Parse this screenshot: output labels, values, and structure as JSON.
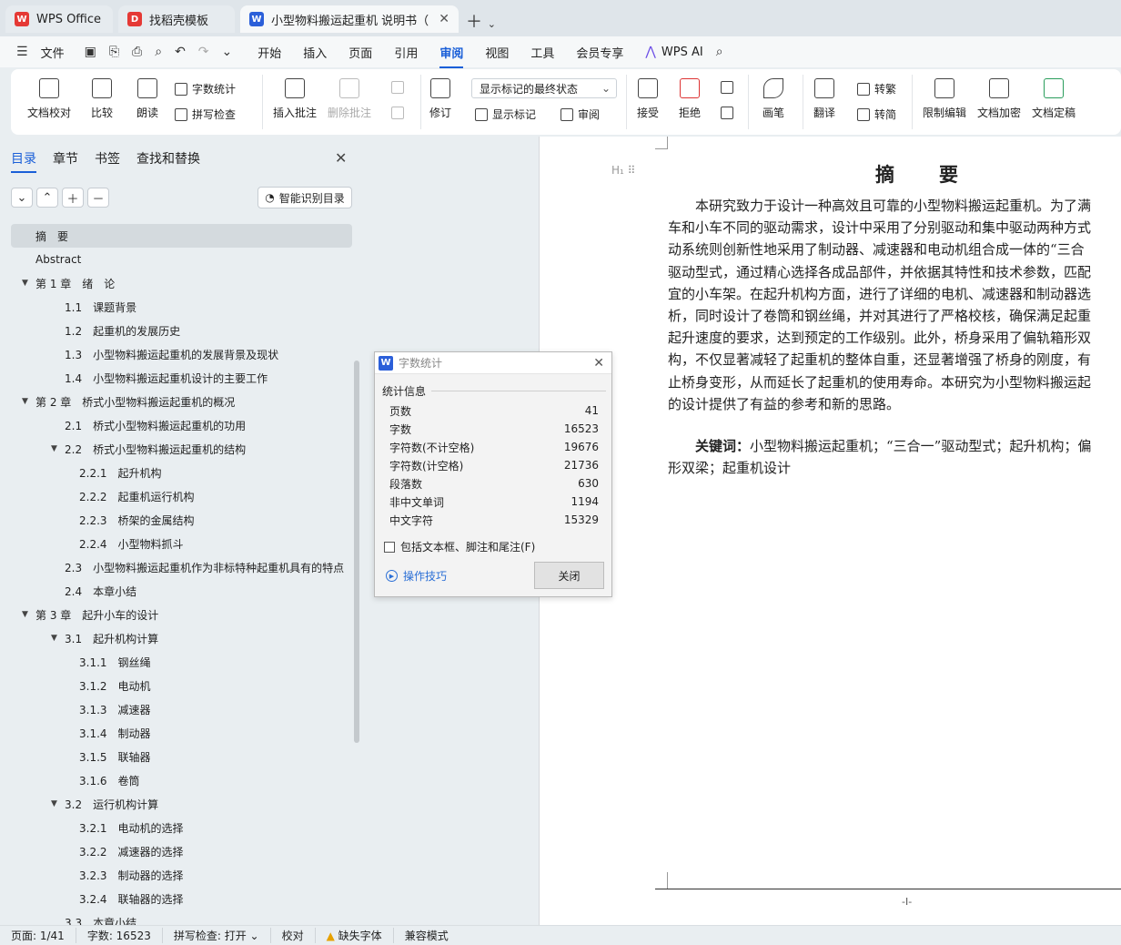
{
  "tabs": [
    {
      "label": "WPS Office",
      "icon": "wps-logo-icon",
      "color": "#e53935"
    },
    {
      "label": "找稻壳模板",
      "icon": "docer-icon",
      "color": "#e53935"
    },
    {
      "label": "小型物料搬运起重机 说明书（",
      "icon": "word-doc-icon",
      "color": "#2b5fd9"
    }
  ],
  "menu": {
    "file": "文件",
    "items": [
      "开始",
      "插入",
      "页面",
      "引用",
      "审阅",
      "视图",
      "工具",
      "会员专享"
    ],
    "active": "审阅",
    "ai": "WPS AI"
  },
  "ribbon": {
    "doc_check": "文档校对",
    "compare": "比较",
    "read_aloud": "朗读",
    "word_count": "字数统计",
    "spell_check": "拼写检查",
    "insert_comment": "插入批注",
    "delete_comment": "删除批注",
    "revise": "修订",
    "markup_state": "显示标记的最终状态",
    "show_markup": "显示标记",
    "review_pane": "审阅",
    "accept": "接受",
    "reject": "拒绝",
    "pen": "画笔",
    "translate": "翻译",
    "to_traditional": "转繁",
    "to_simplified": "转简",
    "restrict_edit": "限制编辑",
    "encrypt": "文档加密",
    "finalize": "文档定稿"
  },
  "nav": {
    "tabs": [
      "目录",
      "章节",
      "书签",
      "查找和替换"
    ],
    "smart_toc": "智能识别目录",
    "toc": [
      {
        "label": "摘　要",
        "level": 0,
        "toggle": "",
        "selected": true
      },
      {
        "label": "Abstract",
        "level": 0,
        "toggle": ""
      },
      {
        "label": "第 1 章　绪　论",
        "level": 0,
        "toggle": "▼"
      },
      {
        "label": "1.1　课题背景",
        "level": 1,
        "toggle": ""
      },
      {
        "label": "1.2　起重机的发展历史",
        "level": 1,
        "toggle": ""
      },
      {
        "label": "1.3　小型物料搬运起重机的发展背景及现状",
        "level": 1,
        "toggle": ""
      },
      {
        "label": "1.4　小型物料搬运起重机设计的主要工作",
        "level": 1,
        "toggle": ""
      },
      {
        "label": "第 2 章　桥式小型物料搬运起重机的概况",
        "level": 0,
        "toggle": "▼"
      },
      {
        "label": "2.1　桥式小型物料搬运起重机的功用",
        "level": 1,
        "toggle": ""
      },
      {
        "label": "2.2　桥式小型物料搬运起重机的结构",
        "level": 1,
        "toggle": "▼"
      },
      {
        "label": "2.2.1　起升机构",
        "level": 2,
        "toggle": ""
      },
      {
        "label": "2.2.2　起重机运行机构",
        "level": 2,
        "toggle": ""
      },
      {
        "label": "2.2.3　桥架的金属结构",
        "level": 2,
        "toggle": ""
      },
      {
        "label": "2.2.4　小型物料抓斗",
        "level": 2,
        "toggle": ""
      },
      {
        "label": "2.3　小型物料搬运起重机作为非标特种起重机具有的特点",
        "level": 1,
        "toggle": ""
      },
      {
        "label": "2.4　本章小结",
        "level": 1,
        "toggle": ""
      },
      {
        "label": "第 3 章　起升小车的设计",
        "level": 0,
        "toggle": "▼"
      },
      {
        "label": "3.1　起升机构计算",
        "level": 1,
        "toggle": "▼"
      },
      {
        "label": "3.1.1　钢丝绳",
        "level": 2,
        "toggle": ""
      },
      {
        "label": "3.1.2　电动机",
        "level": 2,
        "toggle": ""
      },
      {
        "label": "3.1.3　减速器",
        "level": 2,
        "toggle": ""
      },
      {
        "label": "3.1.4　制动器",
        "level": 2,
        "toggle": ""
      },
      {
        "label": "3.1.5　联轴器",
        "level": 2,
        "toggle": ""
      },
      {
        "label": "3.1.6　卷筒",
        "level": 2,
        "toggle": ""
      },
      {
        "label": "3.2　运行机构计算",
        "level": 1,
        "toggle": "▼"
      },
      {
        "label": "3.2.1　电动机的选择",
        "level": 2,
        "toggle": ""
      },
      {
        "label": "3.2.2　减速器的选择",
        "level": 2,
        "toggle": ""
      },
      {
        "label": "3.2.3　制动器的选择",
        "level": 2,
        "toggle": ""
      },
      {
        "label": "3.2.4　联轴器的选择",
        "level": 2,
        "toggle": ""
      },
      {
        "label": "3.3　本章小结",
        "level": 1,
        "toggle": ""
      }
    ]
  },
  "document": {
    "title": "摘　要",
    "body_lines": [
      "　　本研究致力于设计一种高效且可靠的小型物料搬运起重机。为了满",
      "车和小车不同的驱动需求，设计中采用了分别驱动和集中驱动两种方式",
      "动系统则创新性地采用了制动器、减速器和电动机组合成一体的“三合",
      "驱动型式，通过精心选择各成品部件，并依据其特性和技术参数，匹配",
      "宜的小车架。在起升机构方面，进行了详细的电机、减速器和制动器选",
      "析，同时设计了卷筒和钢丝绳，并对其进行了严格校核，确保满足起重",
      "起升速度的要求，达到预定的工作级别。此外，桥身采用了偏轨箱形双",
      "构，不仅显著减轻了起重机的整体自重，还显著增强了桥身的刚度，有",
      "止桥身变形，从而延长了起重机的使用寿命。本研究为小型物料搬运起",
      "的设计提供了有益的参考和新的思路。"
    ],
    "keywords_label": "关键词：",
    "keywords_line1": "小型物料搬运起重机；“三合一”驱动型式；起升机构；偏",
    "keywords_line2": "形双梁；起重机设计",
    "page_number": "-I-"
  },
  "dialog": {
    "title": "字数统计",
    "section": "统计信息",
    "stats": [
      {
        "label": "页数",
        "value": "41"
      },
      {
        "label": "字数",
        "value": "16523"
      },
      {
        "label": "字符数(不计空格)",
        "value": "19676"
      },
      {
        "label": "字符数(计空格)",
        "value": "21736"
      },
      {
        "label": "段落数",
        "value": "630"
      },
      {
        "label": "非中文单词",
        "value": "1194"
      },
      {
        "label": "中文字符",
        "value": "15329"
      }
    ],
    "include_label": "包括文本框、脚注和尾注(F)",
    "include_checked": false,
    "tips": "操作技巧",
    "close": "关闭"
  },
  "status": {
    "page": "页面: 1/41",
    "words": "字数: 16523",
    "spell": "拼写检查: 打开",
    "proof": "校对",
    "missing_font": "缺失字体",
    "compat": "兼容模式"
  }
}
